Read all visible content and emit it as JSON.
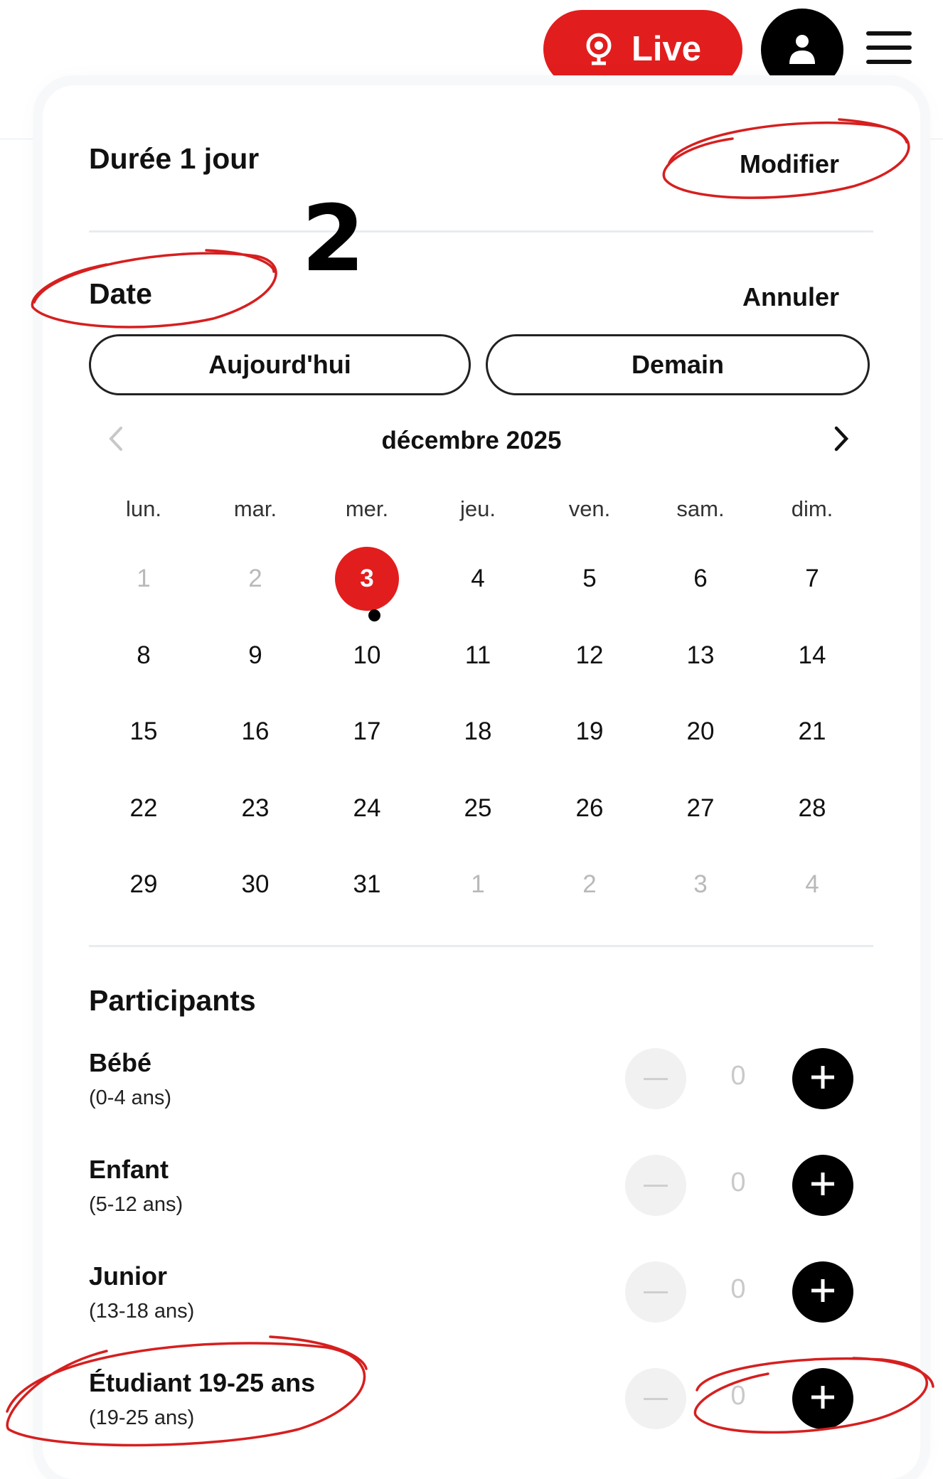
{
  "header": {
    "live_label": "Live",
    "live_icon": "webcam-icon",
    "account_icon": "user-icon",
    "menu_icon": "hamburger-icon"
  },
  "duration": {
    "label": "Durée  1 jour",
    "action": "Modifier"
  },
  "step_number": "2",
  "date": {
    "label": "Date",
    "action": "Annuler",
    "quick": {
      "today": "Aujourd'hui",
      "tomorrow": "Demain"
    }
  },
  "calendar": {
    "month": "décembre 2025",
    "weekdays": [
      "lun.",
      "mar.",
      "mer.",
      "jeu.",
      "ven.",
      "sam.",
      "dim."
    ],
    "weeks": [
      [
        "1",
        "2",
        "3",
        "4",
        "5",
        "6",
        "7"
      ],
      [
        "8",
        "9",
        "10",
        "11",
        "12",
        "13",
        "14"
      ],
      [
        "15",
        "16",
        "17",
        "18",
        "19",
        "20",
        "21"
      ],
      [
        "22",
        "23",
        "24",
        "25",
        "26",
        "27",
        "28"
      ],
      [
        "29",
        "30",
        "31",
        "1",
        "2",
        "3",
        "4"
      ]
    ],
    "selected_day": "3",
    "colors": {
      "selected": "#e21d1d",
      "muted": "#b9b9b9"
    }
  },
  "participants": {
    "title": "Participants",
    "items": [
      {
        "name": "Bébé",
        "age": "(0-4 ans)",
        "count": "0"
      },
      {
        "name": "Enfant",
        "age": "(5-12 ans)",
        "count": "0"
      },
      {
        "name": "Junior",
        "age": "(13-18 ans)",
        "count": "0"
      },
      {
        "name": "Étudiant 19-25 ans",
        "age": "(19-25 ans)",
        "count": "0"
      }
    ]
  },
  "colors": {
    "accent": "#e21d1d",
    "annotation": "#d61f1f"
  }
}
